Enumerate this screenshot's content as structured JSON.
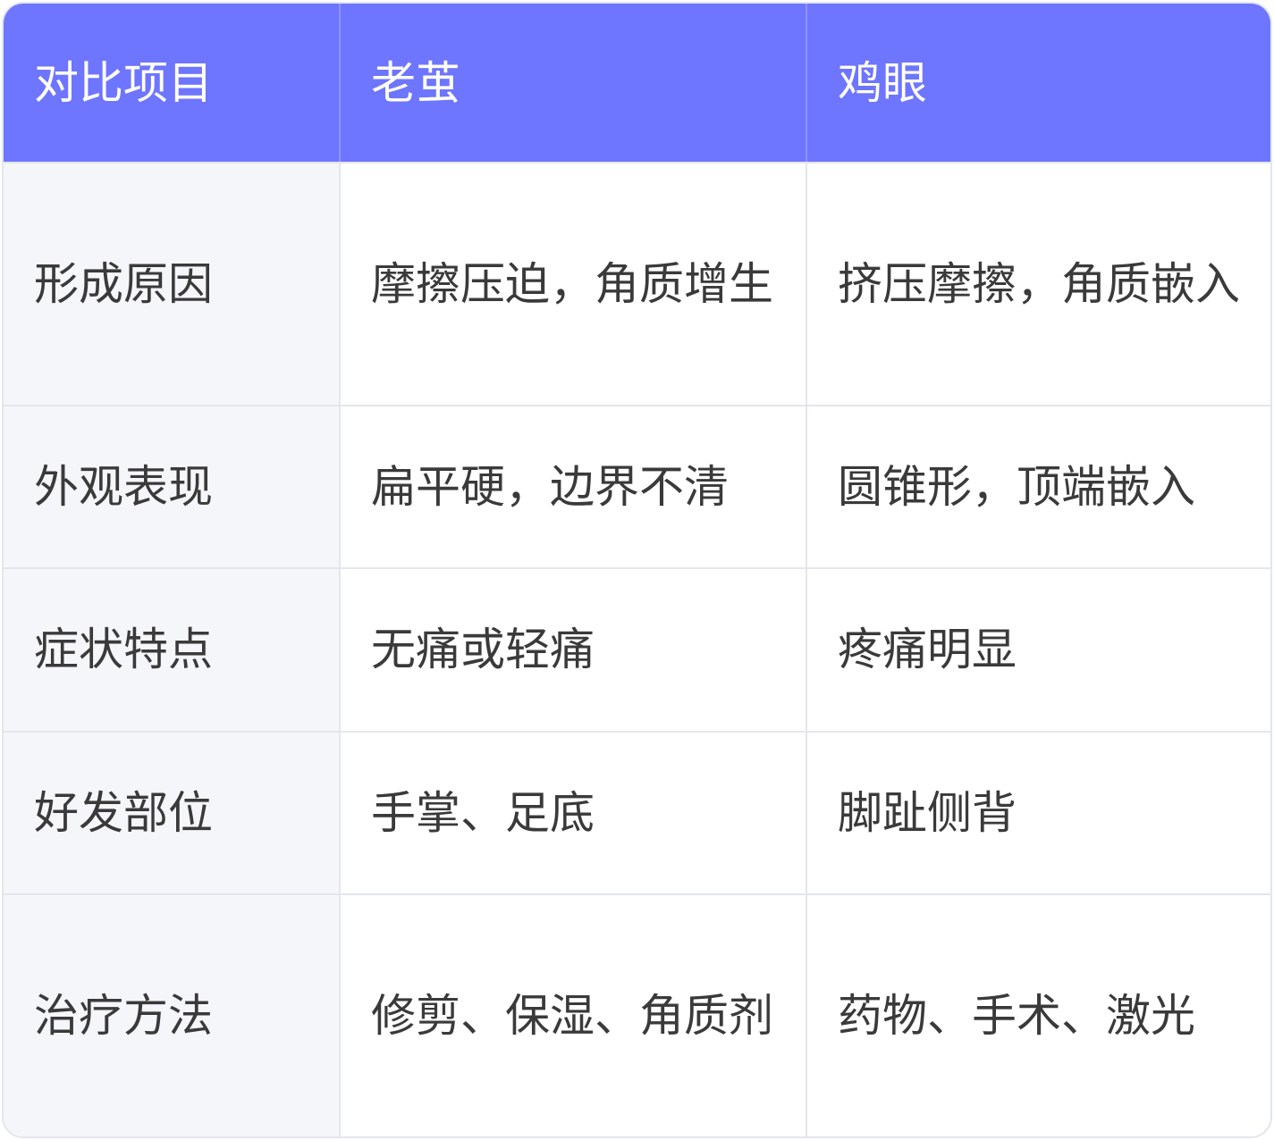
{
  "table": {
    "headers": [
      "对比项目",
      "老茧",
      "鸡眼"
    ],
    "rows": [
      {
        "item": "形成原因",
        "callus": "摩擦压迫，角质增生",
        "corn": "挤压摩擦，角质嵌入"
      },
      {
        "item": "外观表现",
        "callus": "扁平硬，边界不清",
        "corn": "圆锥形，顶端嵌入"
      },
      {
        "item": "症状特点",
        "callus": "无痛或轻痛",
        "corn": "疼痛明显"
      },
      {
        "item": "好发部位",
        "callus": "手掌、足底",
        "corn": "脚趾侧背"
      },
      {
        "item": "治疗方法",
        "callus": "修剪、保湿、角质剂",
        "corn": "药物、手术、激光"
      }
    ]
  },
  "colors": {
    "header_bg": "#6e75ff",
    "header_text": "#ffffff",
    "label_bg": "#f5f6fa",
    "border": "#e4e6ec",
    "text": "#3a3a3a"
  }
}
